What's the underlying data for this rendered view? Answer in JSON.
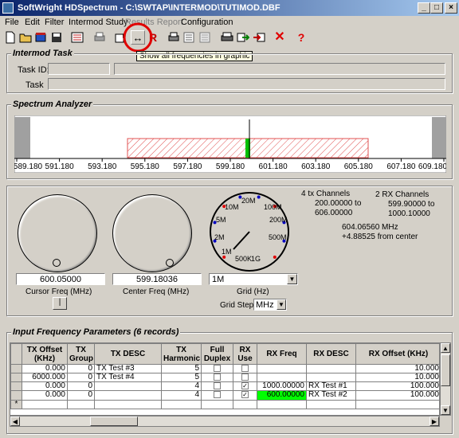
{
  "window": {
    "title": "SoftWright HDSpectrum - C:\\SWTAP\\INTERMOD\\TUTIMOD.DBF",
    "min": "_",
    "max": "□",
    "close": "×"
  },
  "menu": [
    "File",
    "Edit",
    "Filter",
    "Intermod Study",
    "Results Report",
    "Configuration"
  ],
  "toolbar": {
    "tooltip": "Show all frequencies in graphic",
    "show_all_icon": "↔",
    "r_icon": "R",
    "close_icon": "✕",
    "help_icon": "?"
  },
  "intermod_task": {
    "title": "Intermod Task",
    "task_id_label": "Task ID:",
    "task_label": "Task",
    "task_id": "",
    "task_id_desc": "",
    "task": ""
  },
  "spectrum": {
    "title": "Spectrum Analyzer",
    "ticks": [
      "589.180",
      "591.180",
      "593.180",
      "595.180",
      "597.180",
      "599.180",
      "601.180",
      "603.180",
      "605.180",
      "607.180",
      "609.180"
    ]
  },
  "knobs": {
    "cursor_value": "600.05000",
    "cursor_label": "Cursor Freq (MHz)",
    "cursor_btn": "|",
    "center_value": "599.18036",
    "center_label": "Center Freq (MHz)",
    "grid_value": "1M",
    "grid_label": "Grid (Hz)",
    "gridstep_label": "Grid Step",
    "gridstep_value": "MHz"
  },
  "dial_labels": [
    "20M",
    "10M",
    "100M",
    "5M",
    "200M",
    "2M",
    "500M",
    "1M",
    "500K",
    "1G"
  ],
  "info": {
    "tx_head": "4 tx Channels",
    "tx_range1": "200.00000 to",
    "tx_range2": "606.00000",
    "rx_head": "2 RX Channels",
    "rx_range1": "599.90000 to",
    "rx_range2": "1000.10000",
    "freq": "604.06560 MHz",
    "offset": "+4.88525 from center"
  },
  "input_params": {
    "title": "Input Frequency Parameters (6 records)",
    "headers": [
      "TX Offset (KHz)",
      "TX Group",
      "TX DESC",
      "TX Harmonic",
      "Full Duplex",
      "RX Use",
      "RX Freq",
      "RX DESC",
      "RX Offset (KHz)"
    ],
    "rows": [
      {
        "tx_offset": "0.000",
        "tx_group": "0",
        "tx_desc": "TX Test #3",
        "tx_harm": "5",
        "full": false,
        "rxuse": false,
        "rx_freq": "",
        "rx_desc": "",
        "rx_offset": "10.000"
      },
      {
        "tx_offset": "6000.000",
        "tx_group": "0",
        "tx_desc": "TX Test #4",
        "tx_harm": "5",
        "full": false,
        "rxuse": false,
        "rx_freq": "",
        "rx_desc": "",
        "rx_offset": "10.000"
      },
      {
        "tx_offset": "0.000",
        "tx_group": "0",
        "tx_desc": "",
        "tx_harm": "4",
        "full": false,
        "rxuse": true,
        "rx_freq": "1000.00000",
        "rx_desc": "RX Test #1",
        "rx_offset": "100.000"
      },
      {
        "tx_offset": "0.000",
        "tx_group": "0",
        "tx_desc": "",
        "tx_harm": "4",
        "full": false,
        "rxuse": true,
        "rx_freq": "600.00000",
        "rx_desc": "RX Test #2",
        "rx_offset": "100.000"
      }
    ],
    "new_row_marker": "*"
  },
  "colors": {
    "highlight": "#00ff00",
    "tx_band": "#e05050",
    "annotation": "#e00000"
  }
}
